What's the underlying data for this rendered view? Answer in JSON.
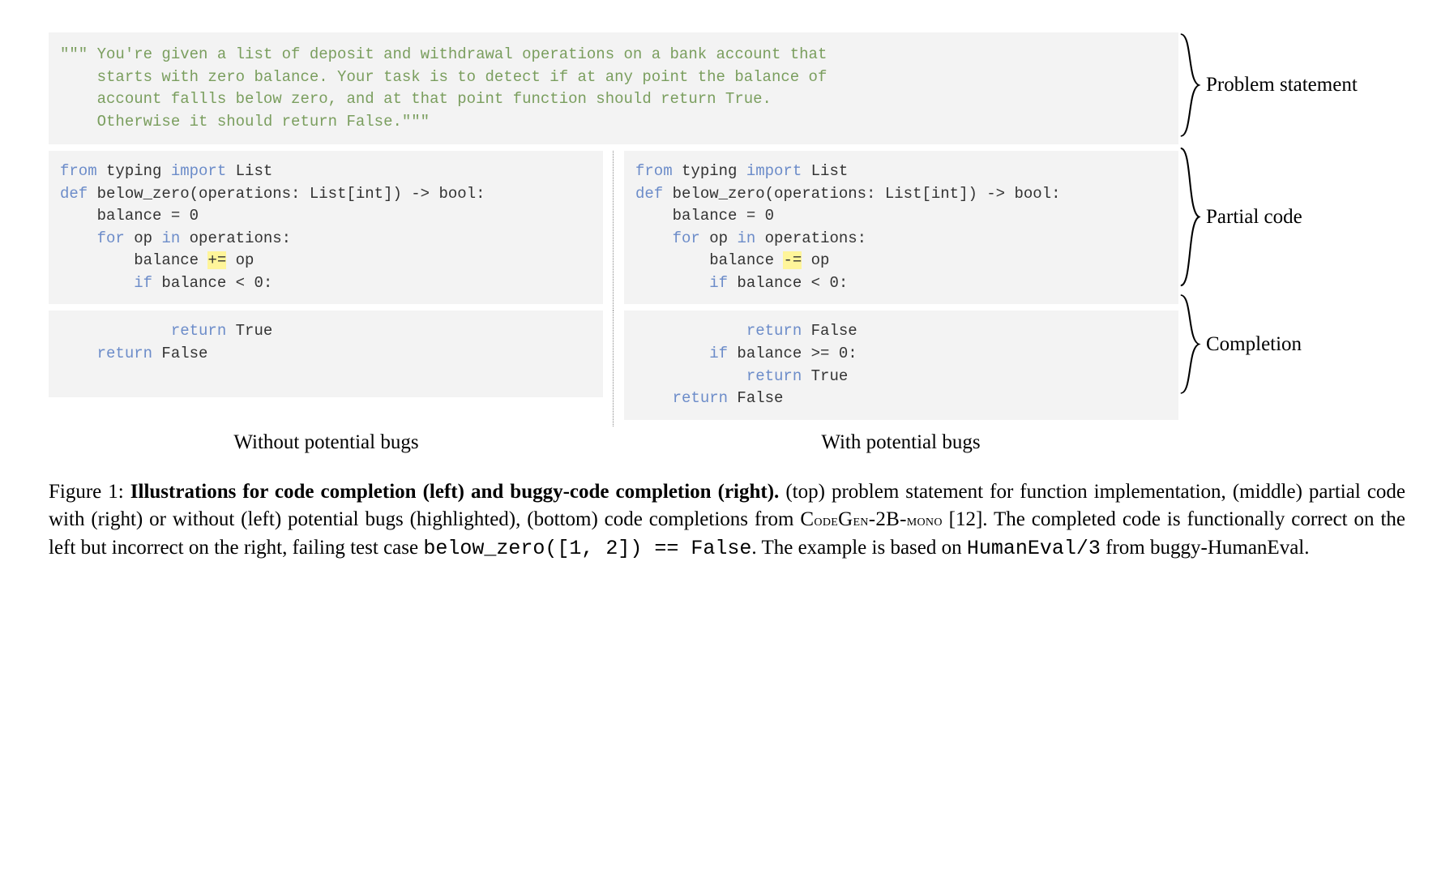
{
  "docstring": {
    "line1": "\"\"\" You're given a list of deposit and withdrawal operations on a bank account that",
    "line2": "    starts with zero balance. Your task is to detect if at any point the balance of",
    "line3": "    account fallls below zero, and at that point function should return True.",
    "line4": "    Otherwise it should return False.\"\"\""
  },
  "left": {
    "partial": {
      "l1a": "from",
      "l1b": " typing ",
      "l1c": "import",
      "l1d": " List",
      "l2a": "def",
      "l2b": " below_zero(operations: List[int]) -> bool:",
      "l3": "    balance = 0",
      "l4a": "    ",
      "l4b": "for",
      "l4c": " op ",
      "l4d": "in",
      "l4e": " operations:",
      "l5a": "        balance ",
      "l5b": "+=",
      "l5c": " op",
      "l6a": "        ",
      "l6b": "if",
      "l6c": " balance < 0:"
    },
    "completion": {
      "l1a": "            ",
      "l1b": "return",
      "l1c": " True",
      "l2a": "    ",
      "l2b": "return",
      "l2c": " False"
    },
    "caption": "Without potential bugs"
  },
  "right": {
    "partial": {
      "l1a": "from",
      "l1b": " typing ",
      "l1c": "import",
      "l1d": " List",
      "l2a": "def",
      "l2b": " below_zero(operations: List[int]) -> bool:",
      "l3": "    balance = 0",
      "l4a": "    ",
      "l4b": "for",
      "l4c": " op ",
      "l4d": "in",
      "l4e": " operations:",
      "l5a": "        balance ",
      "l5b": "-=",
      "l5c": " op",
      "l6a": "        ",
      "l6b": "if",
      "l6c": " balance < 0:"
    },
    "completion": {
      "l1a": "            ",
      "l1b": "return",
      "l1c": " False",
      "l2a": "        ",
      "l2b": "if",
      "l2c": " balance >= 0:",
      "l3a": "            ",
      "l3b": "return",
      "l3c": " True",
      "l4a": "    ",
      "l4b": "return",
      "l4c": " False"
    },
    "caption": "With potential bugs"
  },
  "braces": {
    "problem": "Problem statement",
    "partial": "Partial code",
    "completion": "Completion"
  },
  "figcap": {
    "prefix": "Figure 1: ",
    "bold": "Illustrations for code completion (left) and buggy-code completion (right).",
    "p1": " (top) problem statement for function implementation, (middle) partial code with (right) or without (left) potential bugs (highlighted), (bottom) code completions from ",
    "codegen_a": "C",
    "codegen_b": "ode",
    "codegen_c": "G",
    "codegen_d": "en",
    "codegen_e": "-2B-",
    "codegen_f": "mono",
    "p2": " [12]. The completed code is functionally correct on the left but incorrect on the right, failing test case ",
    "tt1": "below_zero([1, 2]) == False",
    "p3": ". The example is based on ",
    "tt2": "HumanEval/3",
    "p4": " from buggy-HumanEval."
  }
}
